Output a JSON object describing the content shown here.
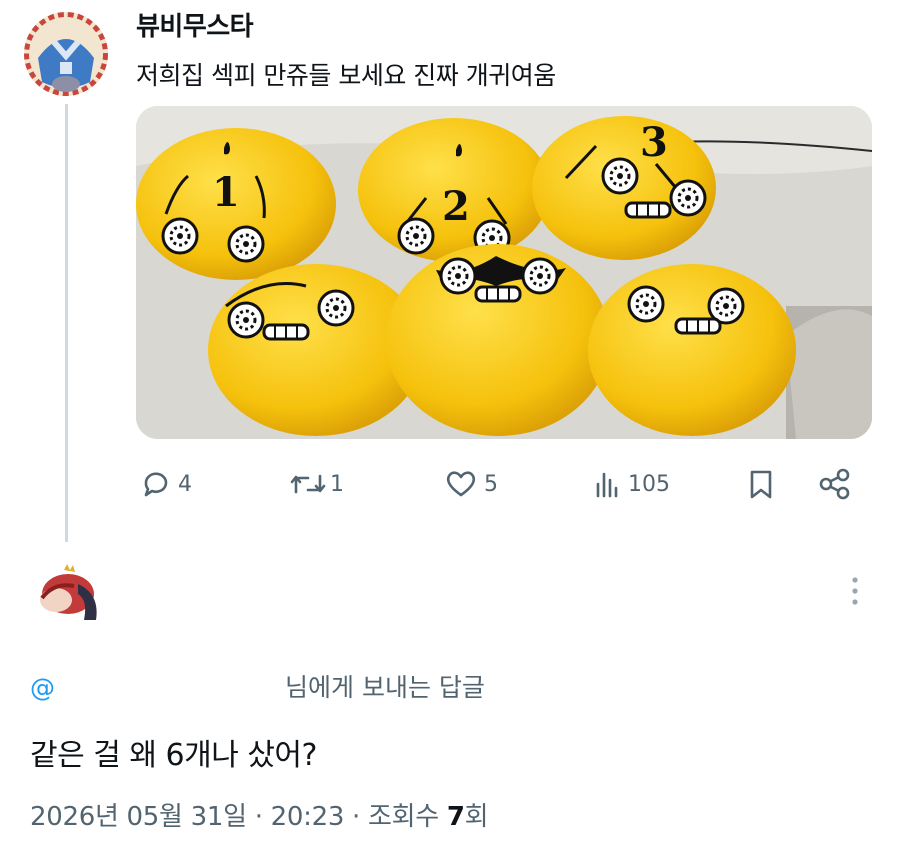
{
  "tweet": {
    "author_name": "뷰비무스타",
    "text": "저희집 섹피 만쥬들 보세요 진짜 개귀여움",
    "plush_numbers": [
      "1",
      "2",
      "3"
    ],
    "actions": {
      "replies": "4",
      "retweets": "1",
      "likes": "5",
      "views": "105"
    }
  },
  "reply": {
    "reply_to_prefix": "@",
    "reply_to_suffix": "님에게 보내는 답글",
    "text": "같은 걸 왜 6개나 샀어?",
    "meta": {
      "date": "2026년 05월 31일",
      "sep1": " · ",
      "time": "20:23",
      "sep2": " · ",
      "views_label": "조회수 ",
      "views_count": "7",
      "views_unit": "회"
    }
  },
  "colors": {
    "text": "#0f1419",
    "secondary": "#536471",
    "accent": "#1d9bf0",
    "thread_line": "#cfd9de",
    "plush_yellow": "#f7c20e"
  },
  "icons": [
    "reply-icon",
    "retweet-icon",
    "like-icon",
    "views-icon",
    "bookmark-icon",
    "share-icon",
    "more-icon"
  ]
}
